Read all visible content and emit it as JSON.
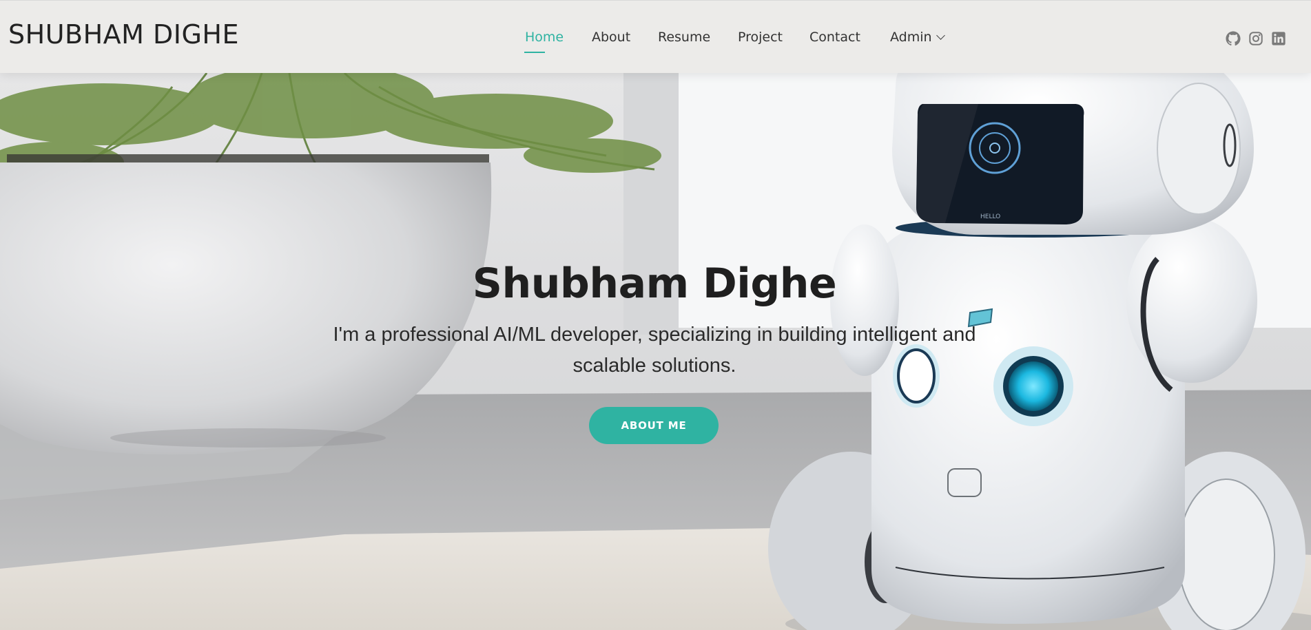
{
  "site": {
    "logo": "SHUBHAM DIGHE"
  },
  "nav": {
    "items": [
      {
        "label": "Home",
        "active": true
      },
      {
        "label": "About"
      },
      {
        "label": "Resume"
      },
      {
        "label": "Project"
      },
      {
        "label": "Contact"
      },
      {
        "label": "Admin",
        "has_dropdown": true
      }
    ]
  },
  "social": [
    {
      "icon": "github-icon"
    },
    {
      "icon": "instagram-icon"
    },
    {
      "icon": "linkedin-icon"
    }
  ],
  "hero": {
    "title": "Shubham Dighe",
    "subtitle": "I'm a professional AI/ML developer, specializing in building intelligent and scalable solutions.",
    "button_label": "ABOUT ME",
    "robot_label": "HELLO"
  },
  "colors": {
    "accent": "#2fb3a2",
    "header_bg": "#ecebe9",
    "text_dark": "#1f1f1f"
  }
}
